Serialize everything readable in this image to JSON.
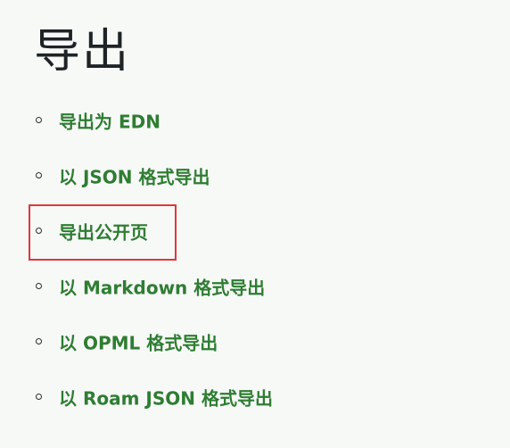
{
  "page": {
    "title": "导出"
  },
  "export_options": [
    {
      "label": "导出为 EDN"
    },
    {
      "label": "以 JSON 格式导出"
    },
    {
      "label": "导出公开页"
    },
    {
      "label": "以 Markdown 格式导出"
    },
    {
      "label": "以 OPML 格式导出"
    },
    {
      "label": "以 Roam JSON 格式导出"
    }
  ],
  "colors": {
    "link": "#2e7d32",
    "highlight": "#e0363d",
    "background": "#f7f9f7"
  },
  "highlighted_item": "导出公开页"
}
